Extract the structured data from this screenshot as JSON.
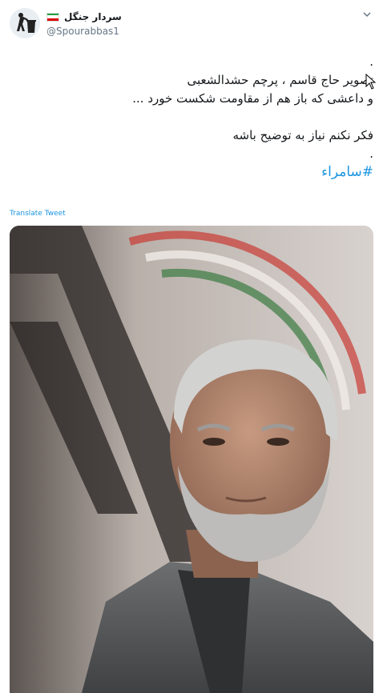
{
  "tweet": {
    "author": {
      "display_name": "سردار جنگل",
      "handle": "@Spourabbas1",
      "avatar_icon": "recycle-man-icon",
      "flag_icon": "iran-flag-icon"
    },
    "menu_icon": "chevron-down-icon",
    "lines": [
      ".",
      "تصویر حاج قاسم ، پرچم حشدالشعبی",
      "و داعشی که باز هم از مقاومت شکست خورد ...",
      "",
      "فکر نکنم نیاز به توضیح باشه",
      "."
    ],
    "hashtag": "#سامراء",
    "translate_label": "Translate Tweet",
    "colors": {
      "link": "#1b95e0",
      "text": "#14171a",
      "secondary": "#657786"
    }
  }
}
